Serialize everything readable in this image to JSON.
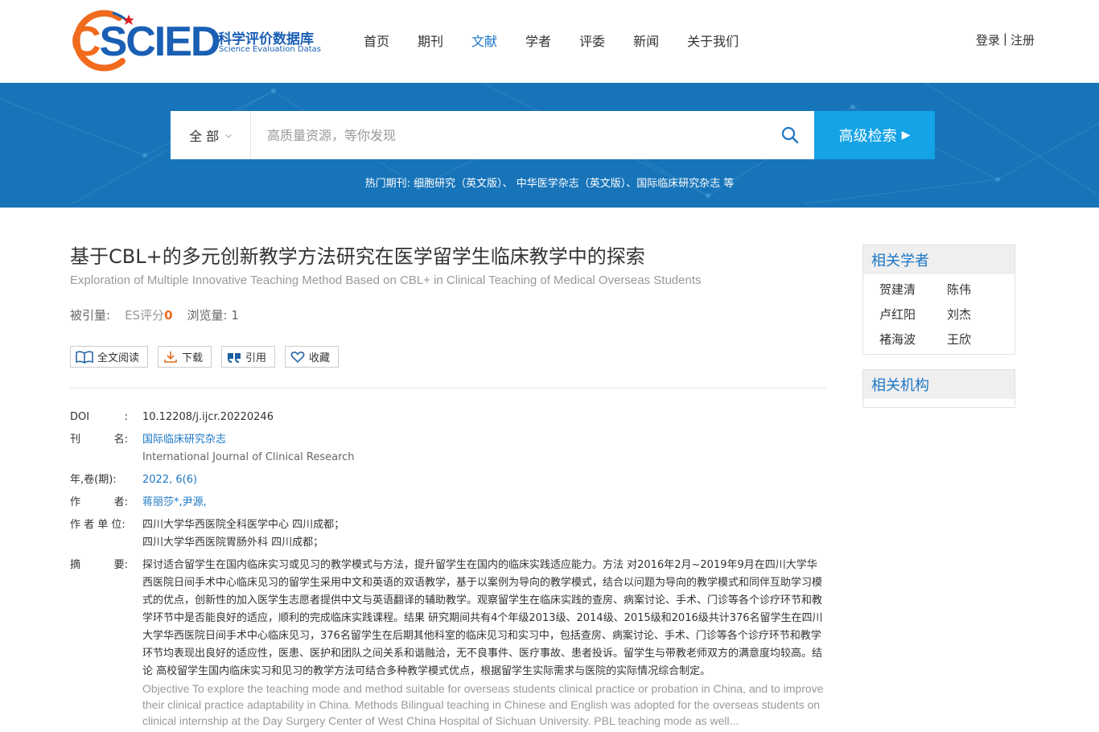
{
  "header": {
    "logo_text_c": "C",
    "logo_text_rest": "SCIED",
    "logo_cn": "科学评价数据库",
    "logo_en": "Science Evaluation Datas",
    "nav": [
      "首页",
      "期刊",
      "文献",
      "学者",
      "评委",
      "新闻",
      "关于我们"
    ],
    "active_nav": "文献",
    "login": "登录",
    "sep": "|",
    "register": "注册"
  },
  "search": {
    "scope": "全 部",
    "placeholder": "高质量资源，等你发现",
    "advanced": "高级检索",
    "hot_label": "热门期刊:",
    "hot_journals": "细胞研究（英文版）、 中华医学杂志（英文版）、国际临床研究杂志 等"
  },
  "article": {
    "title": "基于CBL+的多元创新教学方法研究在医学留学生临床教学中的探索",
    "subtitle": "Exploration of Multiple Innovative Teaching Method Based on CBL+ in Clinical Teaching of Medical Overseas Students",
    "cited_label": "被引量:",
    "es_label": "ES评分",
    "es_value": "0",
    "views_label": "浏览量:",
    "views_value": "1",
    "actions": {
      "read": "全文阅读",
      "download": "下载",
      "cite": "引用",
      "favorite": "收藏"
    },
    "meta": {
      "doi_label_a": "DOI",
      "doi_label_b": ":",
      "doi": "10.12208/j.ijcr.20220246",
      "journal_label_a": "刊",
      "journal_label_b": "名:",
      "journal_cn": "国际临床研究杂志",
      "journal_en": "International Journal of Clinical Research",
      "year_label": "年,卷(期):",
      "year": "2022, 6(6)",
      "author_label_a": "作",
      "author_label_b": "者:",
      "authors": "蒋丽莎*,尹源,",
      "unit_label": "作 者 单 位:",
      "unit1": "四川大学华西医院全科医学中心 四川成都；",
      "unit2": "四川大学华西医院胃肠外科 四川成都；",
      "abs_label_a": "摘",
      "abs_label_b": "要:",
      "abstract_cn": "探讨适合留学生在国内临床实习或见习的教学模式与方法，提升留学生在国内的临床实践适应能力。方法 对2016年2月~2019年9月在四川大学华西医院日间手术中心临床见习的留学生采用中文和英语的双语教学，基于以案例为导向的教学模式，结合以问题为导向的教学模式和同伴互助学习模式的优点，创新性的加入医学生志愿者提供中文与英语翻译的辅助教学。观察留学生在临床实践的查房、病案讨论、手术、门诊等各个诊疗环节和教学环节中是否能良好的适应，顺利的完成临床实践课程。结果 研究期间共有4个年级2013级、2014级、2015级和2016级共计376名留学生在四川大学华西医院日间手术中心临床见习，376名留学生在后期其他科室的临床见习和实习中，包括查房、病案讨论、手术、门诊等各个诊疗环节和教学环节均表现出良好的适应性，医患、医护和团队之间关系和谐融洽，无不良事件、医疗事故、患者投诉。留学生与带教老师双方的满意度均较高。结论 高校留学生国内临床实习和见习的教学方法可结合多种教学模式优点，根据留学生实际需求与医院的实际情况综合制定。",
      "abstract_en": "Objective To explore the teaching mode and method suitable for overseas students clinical practice or probation in China, and to improve their clinical practice adaptability in China. Methods Bilingual teaching in Chinese and English was adopted for the overseas students on clinical internship at the Day Surgery Center of West China Hospital of Sichuan University. PBL teaching mode as well..."
    }
  },
  "sidebar": {
    "scholars_title": "相关学者",
    "scholars": [
      "贺建清",
      "陈伟",
      "卢红阳",
      "刘杰",
      "褚海波",
      "王欣"
    ],
    "orgs_title": "相关机构"
  }
}
